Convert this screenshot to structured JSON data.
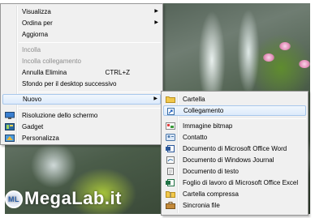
{
  "context_menu": {
    "items": [
      {
        "label": "Visualizza",
        "has_submenu": true
      },
      {
        "label": "Ordina per",
        "has_submenu": true
      },
      {
        "label": "Aggiorna"
      },
      {
        "label": "Incolla",
        "disabled": true
      },
      {
        "label": "Incolla collegamento",
        "disabled": true
      },
      {
        "label": "Annulla Elimina",
        "shortcut": "CTRL+Z"
      },
      {
        "label": "Sfondo per il desktop successivo"
      },
      {
        "label": "Nuovo",
        "has_submenu": true,
        "highlighted": true
      },
      {
        "label": "Risoluzione dello schermo",
        "icon": "monitor-icon"
      },
      {
        "label": "Gadget",
        "icon": "gadget-icon"
      },
      {
        "label": "Personalizza",
        "icon": "personalize-icon"
      }
    ]
  },
  "new_submenu": {
    "items": [
      {
        "label": "Cartella",
        "icon": "folder-icon"
      },
      {
        "label": "Collegamento",
        "icon": "shortcut-icon",
        "highlighted": true
      },
      {
        "label": "Immagine bitmap",
        "icon": "bitmap-icon"
      },
      {
        "label": "Contatto",
        "icon": "contact-icon"
      },
      {
        "label": "Documento di Microsoft Office Word",
        "icon": "word-document-icon"
      },
      {
        "label": "Documento di Windows Journal",
        "icon": "journal-document-icon"
      },
      {
        "label": "Documento di testo",
        "icon": "text-document-icon"
      },
      {
        "label": "Foglio di lavoro di Microsoft Office Excel",
        "icon": "excel-document-icon"
      },
      {
        "label": "Cartella compressa",
        "icon": "zip-folder-icon"
      },
      {
        "label": "Sincronia file",
        "icon": "briefcase-icon"
      }
    ]
  },
  "watermark": {
    "badge": "ML",
    "text": "MegaLab.it"
  },
  "colors": {
    "menu_bg": "#f0f0f0",
    "highlight_border": "#a8c8ec",
    "disabled_text": "#8d8d8d"
  }
}
